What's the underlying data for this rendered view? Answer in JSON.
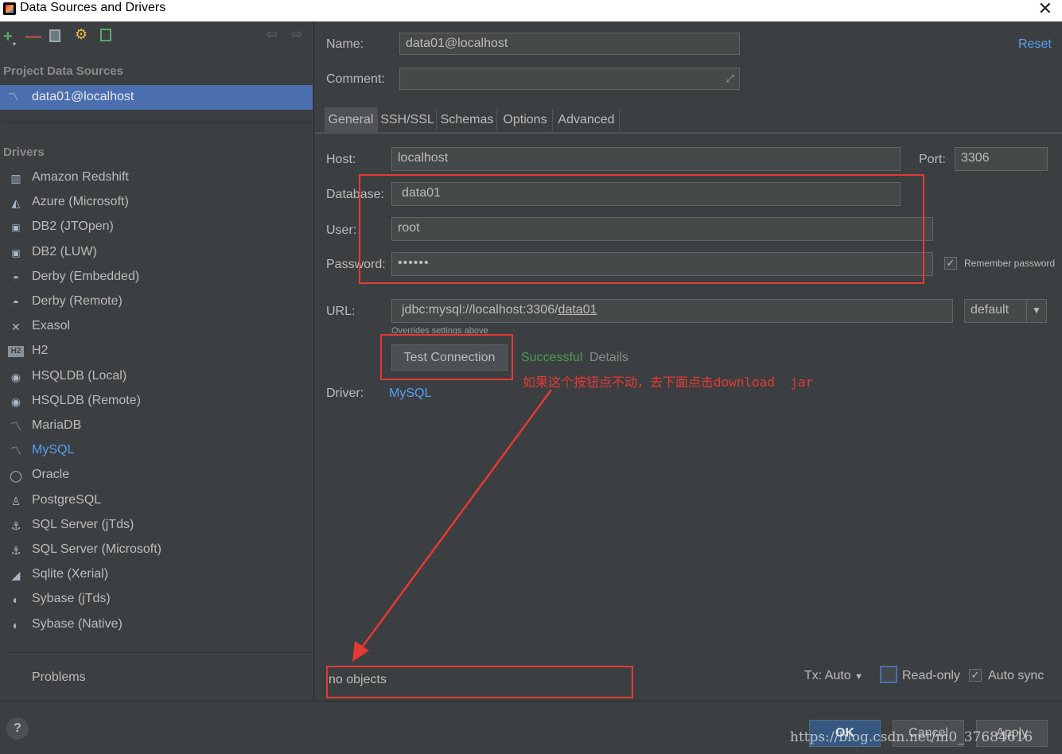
{
  "window": {
    "title": "Data Sources and Drivers"
  },
  "left": {
    "project_section": "Project Data Sources",
    "selected_source": "data01@localhost",
    "drivers_section": "Drivers",
    "drivers": [
      {
        "label": "Amazon Redshift",
        "icon": "redshift-icon"
      },
      {
        "label": "Azure (Microsoft)",
        "icon": "azure-icon"
      },
      {
        "label": "DB2 (JTOpen)",
        "icon": "db2-icon"
      },
      {
        "label": "DB2 (LUW)",
        "icon": "db2-icon"
      },
      {
        "label": "Derby (Embedded)",
        "icon": "derby-icon"
      },
      {
        "label": "Derby (Remote)",
        "icon": "derby-icon"
      },
      {
        "label": "Exasol",
        "icon": "exasol-icon"
      },
      {
        "label": "H2",
        "icon": "h2-icon"
      },
      {
        "label": "HSQLDB (Local)",
        "icon": "hsqldb-icon"
      },
      {
        "label": "HSQLDB (Remote)",
        "icon": "hsqldb-icon"
      },
      {
        "label": "MariaDB",
        "icon": "mariadb-icon"
      },
      {
        "label": "MySQL",
        "icon": "mysql-icon"
      },
      {
        "label": "Oracle",
        "icon": "oracle-icon"
      },
      {
        "label": "PostgreSQL",
        "icon": "postgresql-icon"
      },
      {
        "label": "SQL Server (jTds)",
        "icon": "sqlserver-icon"
      },
      {
        "label": "SQL Server (Microsoft)",
        "icon": "sqlserver-icon"
      },
      {
        "label": "Sqlite (Xerial)",
        "icon": "sqlite-icon"
      },
      {
        "label": "Sybase (jTds)",
        "icon": "sybase-icon"
      },
      {
        "label": "Sybase (Native)",
        "icon": "sybase-icon"
      }
    ],
    "problems": "Problems"
  },
  "form": {
    "name_label": "Name:",
    "name_value": "data01@localhost",
    "reset": "Reset",
    "comment_label": "Comment:",
    "tabs": [
      "General",
      "SSH/SSL",
      "Schemas",
      "Options",
      "Advanced"
    ],
    "host_label": "Host:",
    "host_value": "localhost",
    "port_label": "Port:",
    "port_value": "3306",
    "database_label": "Database:",
    "database_value": "data01",
    "user_label": "User:",
    "user_value": "root",
    "password_label": "Password:",
    "password_value": "••••••",
    "remember_password": "Remember password",
    "url_label": "URL:",
    "url_prefix": "jdbc:mysql://localhost:3306/",
    "url_db": "data01",
    "url_mode": "default",
    "overrides_note": "Overrides settings above",
    "test_connection": "Test Connection",
    "status_successful": "Successful",
    "details": "Details",
    "annotation": "如果这个按钮点不动，去下面点击download  jar",
    "driver_label": "Driver:",
    "driver_value": "MySQL",
    "no_objects": "no objects",
    "tx_label": "Tx: Auto",
    "read_only": "Read-only",
    "auto_sync": "Auto sync"
  },
  "footer": {
    "ok": "OK",
    "cancel": "Cancel",
    "apply": "Apply",
    "watermark": "https://blog.csdn.net/m0_37684616"
  },
  "colors": {
    "background": "#3c3f41",
    "selection": "#4b6eaf",
    "link": "#589df6",
    "success": "#499c54",
    "annotation_red": "#e53935"
  }
}
